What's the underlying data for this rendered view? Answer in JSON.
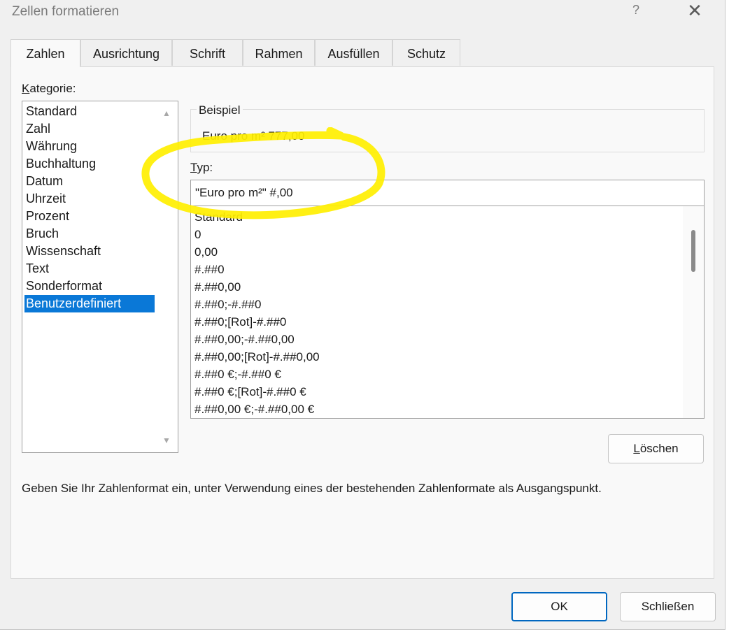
{
  "window": {
    "title": "Zellen formatieren",
    "help_label": "?",
    "close_label": "✕"
  },
  "tabs": [
    {
      "label": "Zahlen",
      "active": true
    },
    {
      "label": "Ausrichtung"
    },
    {
      "label": "Schrift"
    },
    {
      "label": "Rahmen"
    },
    {
      "label": "Ausfüllen"
    },
    {
      "label": "Schutz"
    }
  ],
  "kategorie": {
    "label_underlined": "K",
    "label_rest": "ategorie:",
    "items": [
      "Standard",
      "Zahl",
      "Währung",
      "Buchhaltung",
      "Datum",
      "Uhrzeit",
      "Prozent",
      "Bruch",
      "Wissenschaft",
      "Text",
      "Sonderformat",
      "Benutzerdefiniert"
    ],
    "selected": "Benutzerdefiniert"
  },
  "beispiel": {
    "legend": "Beispiel",
    "value": "Euro pro m² 777,00"
  },
  "typ": {
    "label_underlined": "T",
    "label_rest": "yp:",
    "value": "\"Euro pro m²\" #,00"
  },
  "formats": [
    "Standard",
    "0",
    "0,00",
    "#.##0",
    "#.##0,00",
    "#.##0;-#.##0",
    "#.##0;[Rot]-#.##0",
    "#.##0,00;-#.##0,00",
    "#.##0,00;[Rot]-#.##0,00",
    "#.##0 €;-#.##0 €",
    "#.##0 €;[Rot]-#.##0 €",
    "#.##0,00 €;-#.##0,00 €"
  ],
  "buttons": {
    "loeschen_underlined": "L",
    "loeschen_rest": "öschen",
    "ok": "OK",
    "schliessen": "Schließen"
  },
  "hint": "Geben Sie Ihr Zahlenformat ein, unter Verwendung eines der bestehenden Zahlenformate als Ausgangspunkt.",
  "colors": {
    "selection": "#0a78d7",
    "highlight": "#ffef00",
    "primary_border": "#0067c0"
  }
}
